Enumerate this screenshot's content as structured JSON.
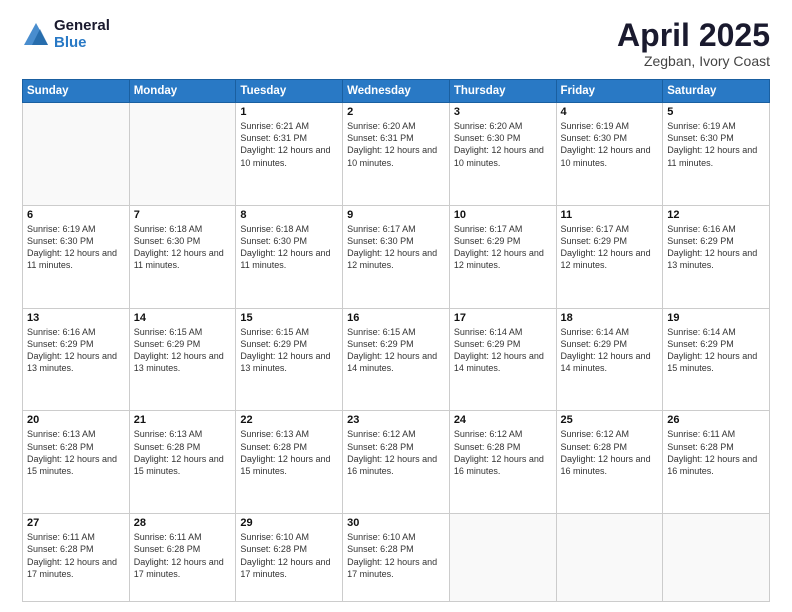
{
  "logo": {
    "general": "General",
    "blue": "Blue"
  },
  "title": {
    "month": "April 2025",
    "location": "Zegban, Ivory Coast"
  },
  "days_of_week": [
    "Sunday",
    "Monday",
    "Tuesday",
    "Wednesday",
    "Thursday",
    "Friday",
    "Saturday"
  ],
  "weeks": [
    [
      {
        "day": "",
        "info": ""
      },
      {
        "day": "",
        "info": ""
      },
      {
        "day": "1",
        "info": "Sunrise: 6:21 AM\nSunset: 6:31 PM\nDaylight: 12 hours and 10 minutes."
      },
      {
        "day": "2",
        "info": "Sunrise: 6:20 AM\nSunset: 6:31 PM\nDaylight: 12 hours and 10 minutes."
      },
      {
        "day": "3",
        "info": "Sunrise: 6:20 AM\nSunset: 6:30 PM\nDaylight: 12 hours and 10 minutes."
      },
      {
        "day": "4",
        "info": "Sunrise: 6:19 AM\nSunset: 6:30 PM\nDaylight: 12 hours and 10 minutes."
      },
      {
        "day": "5",
        "info": "Sunrise: 6:19 AM\nSunset: 6:30 PM\nDaylight: 12 hours and 11 minutes."
      }
    ],
    [
      {
        "day": "6",
        "info": "Sunrise: 6:19 AM\nSunset: 6:30 PM\nDaylight: 12 hours and 11 minutes."
      },
      {
        "day": "7",
        "info": "Sunrise: 6:18 AM\nSunset: 6:30 PM\nDaylight: 12 hours and 11 minutes."
      },
      {
        "day": "8",
        "info": "Sunrise: 6:18 AM\nSunset: 6:30 PM\nDaylight: 12 hours and 11 minutes."
      },
      {
        "day": "9",
        "info": "Sunrise: 6:17 AM\nSunset: 6:30 PM\nDaylight: 12 hours and 12 minutes."
      },
      {
        "day": "10",
        "info": "Sunrise: 6:17 AM\nSunset: 6:29 PM\nDaylight: 12 hours and 12 minutes."
      },
      {
        "day": "11",
        "info": "Sunrise: 6:17 AM\nSunset: 6:29 PM\nDaylight: 12 hours and 12 minutes."
      },
      {
        "day": "12",
        "info": "Sunrise: 6:16 AM\nSunset: 6:29 PM\nDaylight: 12 hours and 13 minutes."
      }
    ],
    [
      {
        "day": "13",
        "info": "Sunrise: 6:16 AM\nSunset: 6:29 PM\nDaylight: 12 hours and 13 minutes."
      },
      {
        "day": "14",
        "info": "Sunrise: 6:15 AM\nSunset: 6:29 PM\nDaylight: 12 hours and 13 minutes."
      },
      {
        "day": "15",
        "info": "Sunrise: 6:15 AM\nSunset: 6:29 PM\nDaylight: 12 hours and 13 minutes."
      },
      {
        "day": "16",
        "info": "Sunrise: 6:15 AM\nSunset: 6:29 PM\nDaylight: 12 hours and 14 minutes."
      },
      {
        "day": "17",
        "info": "Sunrise: 6:14 AM\nSunset: 6:29 PM\nDaylight: 12 hours and 14 minutes."
      },
      {
        "day": "18",
        "info": "Sunrise: 6:14 AM\nSunset: 6:29 PM\nDaylight: 12 hours and 14 minutes."
      },
      {
        "day": "19",
        "info": "Sunrise: 6:14 AM\nSunset: 6:29 PM\nDaylight: 12 hours and 15 minutes."
      }
    ],
    [
      {
        "day": "20",
        "info": "Sunrise: 6:13 AM\nSunset: 6:28 PM\nDaylight: 12 hours and 15 minutes."
      },
      {
        "day": "21",
        "info": "Sunrise: 6:13 AM\nSunset: 6:28 PM\nDaylight: 12 hours and 15 minutes."
      },
      {
        "day": "22",
        "info": "Sunrise: 6:13 AM\nSunset: 6:28 PM\nDaylight: 12 hours and 15 minutes."
      },
      {
        "day": "23",
        "info": "Sunrise: 6:12 AM\nSunset: 6:28 PM\nDaylight: 12 hours and 16 minutes."
      },
      {
        "day": "24",
        "info": "Sunrise: 6:12 AM\nSunset: 6:28 PM\nDaylight: 12 hours and 16 minutes."
      },
      {
        "day": "25",
        "info": "Sunrise: 6:12 AM\nSunset: 6:28 PM\nDaylight: 12 hours and 16 minutes."
      },
      {
        "day": "26",
        "info": "Sunrise: 6:11 AM\nSunset: 6:28 PM\nDaylight: 12 hours and 16 minutes."
      }
    ],
    [
      {
        "day": "27",
        "info": "Sunrise: 6:11 AM\nSunset: 6:28 PM\nDaylight: 12 hours and 17 minutes."
      },
      {
        "day": "28",
        "info": "Sunrise: 6:11 AM\nSunset: 6:28 PM\nDaylight: 12 hours and 17 minutes."
      },
      {
        "day": "29",
        "info": "Sunrise: 6:10 AM\nSunset: 6:28 PM\nDaylight: 12 hours and 17 minutes."
      },
      {
        "day": "30",
        "info": "Sunrise: 6:10 AM\nSunset: 6:28 PM\nDaylight: 12 hours and 17 minutes."
      },
      {
        "day": "",
        "info": ""
      },
      {
        "day": "",
        "info": ""
      },
      {
        "day": "",
        "info": ""
      }
    ]
  ]
}
